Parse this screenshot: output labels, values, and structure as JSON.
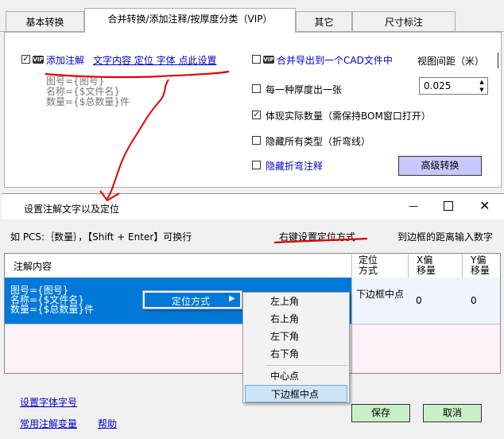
{
  "tabs": [
    "基本转换",
    "合并转换/添加注释/按厚度分类（VIP）",
    "其它",
    "尺寸标注"
  ],
  "vip_badge": "VIP",
  "left": {
    "add_note_label": "添加注解",
    "settings_link": "文字内容 定位 字体 点此设置",
    "preview_lines": [
      "图号={图号}",
      "名称={$文件名}",
      "数量={$总数量}件"
    ]
  },
  "right": {
    "merge_label": "合并导出到一个CAD文件中",
    "view_spacing_label": "视图间距（米）",
    "view_spacing_value": "0.025",
    "per_thickness_label": "每一种厚度出一张",
    "actual_qty_label": "体现实际数量（需保持BOM窗口打开）",
    "hide_types_label": "隐藏所有类型（折弯线）",
    "hide_bend_label": "隐藏折弯注释",
    "advanced_button": "高级转换"
  },
  "checks": {
    "add_note": true,
    "merge": false,
    "per_thickness": false,
    "actual_qty": true,
    "hide_types": false,
    "hide_bend": false
  },
  "check_mark": "✓",
  "dialog": {
    "title": "设置注解文字以及定位",
    "hint": "如 PCS:｛数量｝，【Shift + Enter】可换行",
    "right_hint_1": "右键设置定位方式",
    "right_hint_2": "到边框的距离输入数字",
    "columns": [
      "注解内容",
      "定位方式",
      "X偏移量",
      "Y偏移量"
    ],
    "row": {
      "content_lines": [
        "图号={图号}",
        "名称={$文件名}",
        "数量={$总数量}件"
      ],
      "position": "下边框中点",
      "x_offset": "0",
      "y_offset": "0"
    },
    "link_font": "设置字体字号",
    "link_common": "常用注解变量",
    "link_help": "帮助",
    "save_button": "保存",
    "cancel_button": "取消"
  },
  "context_menu": {
    "item": "定位方式",
    "submenu": [
      "左上角",
      "右上角",
      "左下角",
      "右下角",
      "中心点",
      "下边框中点"
    ],
    "selected_index": 5
  },
  "colors": {
    "selection": "#0078d7",
    "pink": "#fff0fa",
    "button_green": "#c8f0c8",
    "button_purple": "#c8c8ff",
    "annotation_red": "#e00000"
  }
}
